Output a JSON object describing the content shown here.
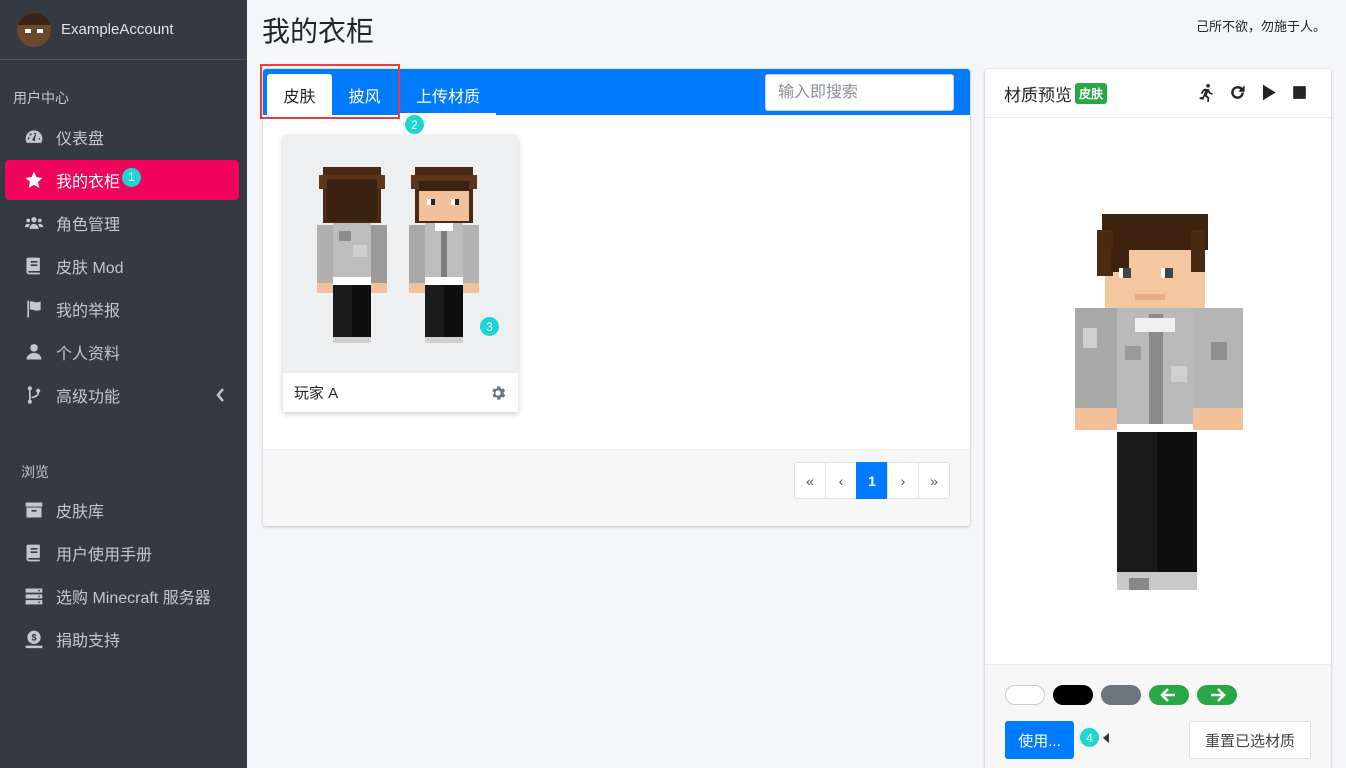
{
  "sidebar": {
    "account_name": "ExampleAccount",
    "section_user": "用户中心",
    "section_browse": "浏览",
    "items": [
      {
        "label": "仪表盘"
      },
      {
        "label": "我的衣柜",
        "step": "1"
      },
      {
        "label": "角色管理"
      },
      {
        "label": "皮肤 Mod"
      },
      {
        "label": "我的举报"
      },
      {
        "label": "个人资料"
      },
      {
        "label": "高级功能"
      }
    ],
    "browse_items": [
      {
        "label": "皮肤库"
      },
      {
        "label": "用户使用手册"
      },
      {
        "label": "选购 Minecraft 服务器"
      },
      {
        "label": "捐助支持"
      }
    ],
    "active_color": "#f0055a"
  },
  "header": {
    "title": "我的衣柜",
    "motto": "己所不欲，勿施于人。"
  },
  "closet": {
    "tabs": [
      {
        "label": "皮肤"
      },
      {
        "label": "披风"
      },
      {
        "label": "上传材质"
      }
    ],
    "tabs_step": "2",
    "search_placeholder": "输入即搜索",
    "items": [
      {
        "name": "玩家 A",
        "step": "3"
      }
    ],
    "pagination": [
      "«",
      "‹",
      "1",
      "›",
      "»"
    ],
    "current_page": "1",
    "accent_color": "#007bff"
  },
  "preview": {
    "title": "材质预览",
    "badge": "皮肤",
    "tools": [
      "run-icon",
      "rotate-icon",
      "play-icon",
      "stop-icon"
    ],
    "bg_swatches": [
      "#ffffff",
      "#000000",
      "#6c757d"
    ],
    "nav_arrows": [
      "arrow-left-icon",
      "arrow-right-icon"
    ],
    "use_button": "使用...",
    "use_step": "4",
    "reset_button": "重置已选材质"
  }
}
